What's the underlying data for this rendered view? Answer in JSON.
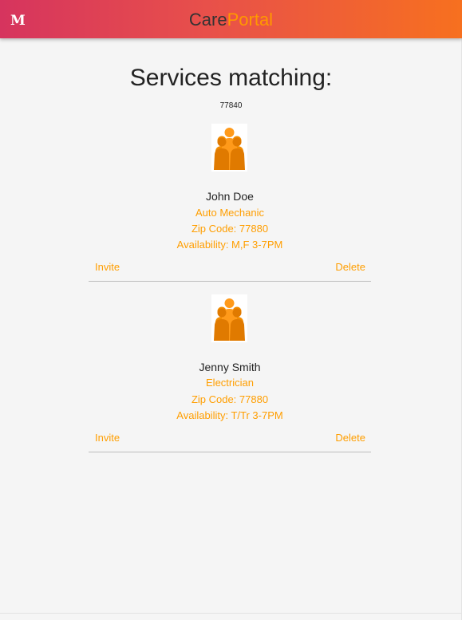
{
  "navbar": {
    "logo": "M",
    "brand_part1": "Care",
    "brand_part2": "Portal"
  },
  "page": {
    "title": "Services matching:",
    "zip_query": "77840"
  },
  "providers": [
    {
      "name": "John Doe",
      "service": "Auto Mechanic",
      "zip": "Zip Code: 77880",
      "availability": "Availability: M,F 3-7PM",
      "invite_label": "Invite",
      "delete_label": "Delete",
      "icon": "people-group-icon"
    },
    {
      "name": "Jenny Smith",
      "service": "Electrician",
      "zip": "Zip Code: 77880",
      "availability": "Availability: T/Tr 3-7PM",
      "invite_label": "Invite",
      "delete_label": "Delete",
      "icon": "people-group-icon"
    }
  ],
  "colors": {
    "accent": "#ff9e00",
    "header_gradient_start": "#d6345e",
    "header_gradient_end": "#f7701f",
    "brand_portal": "#ff9800"
  }
}
